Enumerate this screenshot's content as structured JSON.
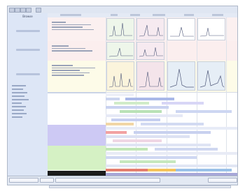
{
  "sidebar": {
    "title": "Browse"
  },
  "statusbar": {
    "hint": ""
  },
  "colors": {
    "accent": "#3a4b7a",
    "panel": "#dde6f6",
    "pink": "#f7dede",
    "yellow": "#fbf7d6",
    "green": "#d9f2c8",
    "lavender": "#c9c6f3"
  }
}
